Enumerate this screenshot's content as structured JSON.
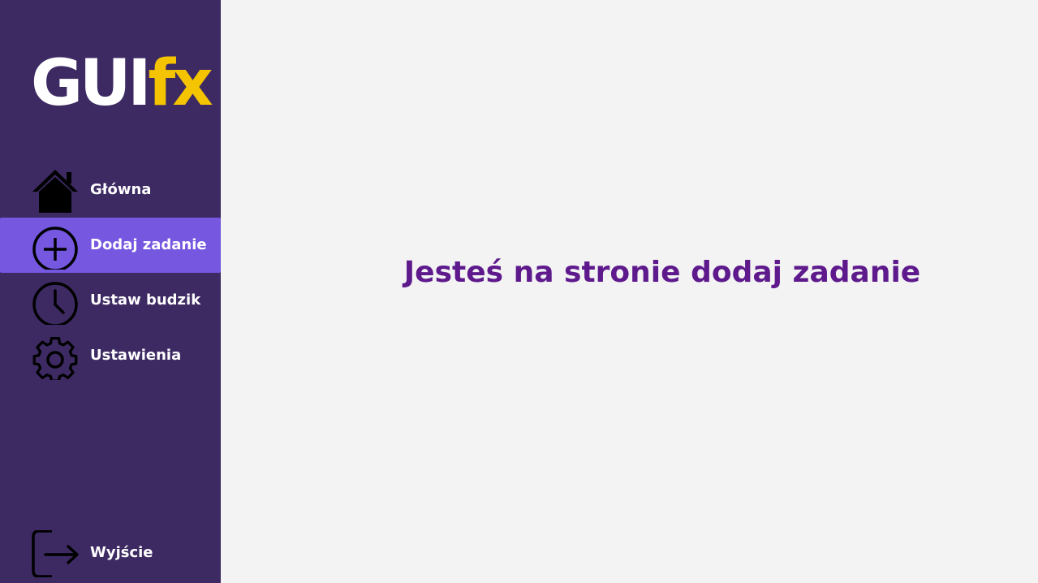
{
  "logo": {
    "part1": "GUI",
    "part2": "fx",
    "part1_color": "#ffffff",
    "part2_color": "#f5c400"
  },
  "sidebar": {
    "background": "#3d2a63",
    "active_background": "#7557e0",
    "items": [
      {
        "label": "Główna",
        "icon": "home-icon",
        "active": false
      },
      {
        "label": "Dodaj zadanie",
        "icon": "plus-circle-icon",
        "active": true
      },
      {
        "label": "Ustaw budzik",
        "icon": "clock-icon",
        "active": false
      },
      {
        "label": "Ustawienia",
        "icon": "gear-icon",
        "active": false
      }
    ],
    "exit": {
      "label": "Wyjście",
      "icon": "logout-icon"
    }
  },
  "main": {
    "heading": "Jesteś na stronie dodaj zadanie",
    "heading_color": "#5e1a8c",
    "background": "#f3f3f3"
  }
}
